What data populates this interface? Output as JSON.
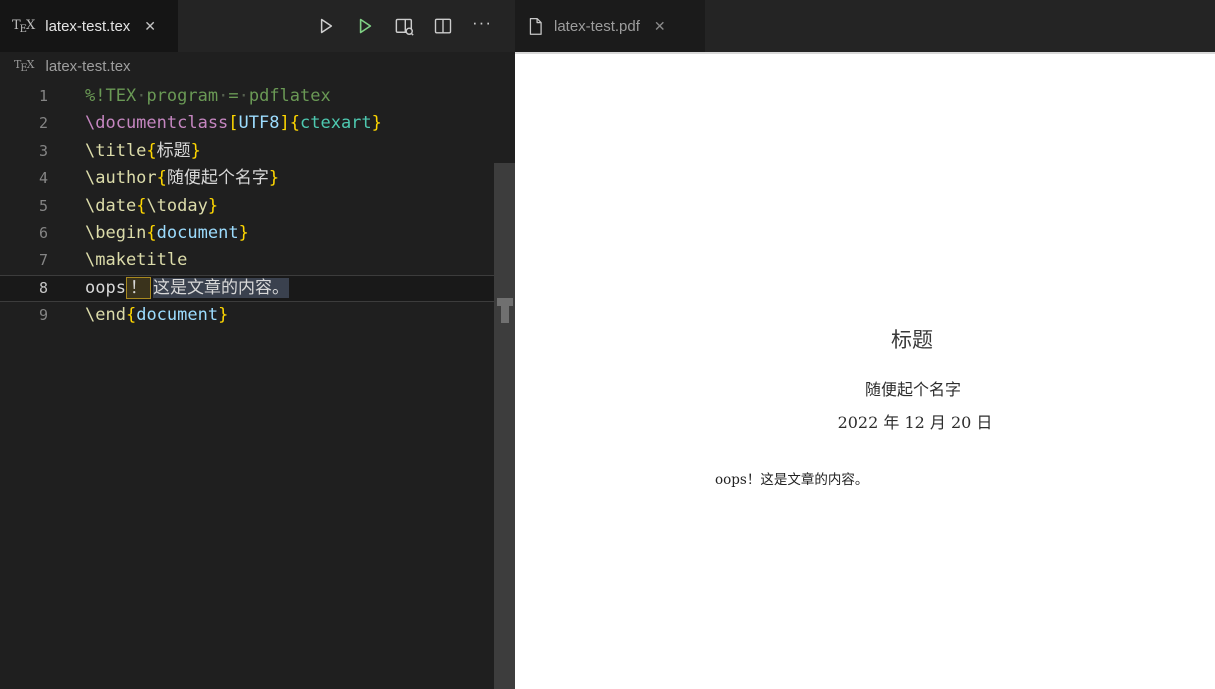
{
  "icons": {
    "close": "✕",
    "more": "···",
    "tex_t": "T",
    "tex_e": "E",
    "tex_x": "X"
  },
  "left_editor": {
    "tab": {
      "label": "latex-test.tex"
    },
    "toolbar": {
      "run": "play-outline",
      "run_green": "play-green",
      "view_pdf": "preview-with-magnifier",
      "split": "split-editor",
      "more": "more-actions"
    },
    "breadcrumb": {
      "label": "latex-test.tex"
    },
    "lines": [
      {
        "n": 1,
        "current": false,
        "spans": [
          {
            "t": "%!TEX",
            "k": "cm"
          },
          {
            "t": "·",
            "k": "ws"
          },
          {
            "t": "program",
            "k": "cm"
          },
          {
            "t": "·",
            "k": "ws"
          },
          {
            "t": "=",
            "k": "cm"
          },
          {
            "t": "·",
            "k": "ws"
          },
          {
            "t": "pdflatex",
            "k": "cm"
          }
        ]
      },
      {
        "n": 2,
        "current": false,
        "spans": [
          {
            "t": "\\documentclass",
            "k": "kw"
          },
          {
            "t": "[",
            "k": "br"
          },
          {
            "t": "UTF8",
            "k": "var"
          },
          {
            "t": "]",
            "k": "br"
          },
          {
            "t": "{",
            "k": "br"
          },
          {
            "t": "ctexart",
            "k": "cls"
          },
          {
            "t": "}",
            "k": "br"
          }
        ]
      },
      {
        "n": 3,
        "current": false,
        "spans": [
          {
            "t": "\\title",
            "k": "fn"
          },
          {
            "t": "{",
            "k": "br"
          },
          {
            "t": "标题",
            "k": "tx"
          },
          {
            "t": "}",
            "k": "br"
          }
        ]
      },
      {
        "n": 4,
        "current": false,
        "spans": [
          {
            "t": "\\author",
            "k": "fn"
          },
          {
            "t": "{",
            "k": "br"
          },
          {
            "t": "随便起个名字",
            "k": "tx"
          },
          {
            "t": "}",
            "k": "br"
          }
        ]
      },
      {
        "n": 5,
        "current": false,
        "spans": [
          {
            "t": "\\date",
            "k": "fn"
          },
          {
            "t": "{",
            "k": "br"
          },
          {
            "t": "\\today",
            "k": "fn"
          },
          {
            "t": "}",
            "k": "br"
          }
        ]
      },
      {
        "n": 6,
        "current": false,
        "spans": [
          {
            "t": "\\begin",
            "k": "fn"
          },
          {
            "t": "{",
            "k": "br"
          },
          {
            "t": "document",
            "k": "var"
          },
          {
            "t": "}",
            "k": "br"
          }
        ]
      },
      {
        "n": 7,
        "current": false,
        "spans": [
          {
            "t": "\\maketitle",
            "k": "fn"
          }
        ]
      },
      {
        "n": 8,
        "current": true,
        "spans": [
          {
            "t": "oops",
            "k": "tx"
          },
          {
            "t": "！",
            "k": "boxed"
          },
          {
            "t": "这是文章的内容。",
            "k": "sel"
          }
        ]
      },
      {
        "n": 9,
        "current": false,
        "spans": [
          {
            "t": "\\end",
            "k": "fn"
          },
          {
            "t": "{",
            "k": "br"
          },
          {
            "t": "document",
            "k": "var"
          },
          {
            "t": "}",
            "k": "br"
          }
        ]
      }
    ]
  },
  "right_editor": {
    "tab": {
      "label": "latex-test.pdf"
    },
    "pdf": {
      "title": "标题",
      "author": "随便起个名字",
      "date": "2022 年 12 月 20 日",
      "body": "oops！这是文章的内容。"
    }
  },
  "colors": {
    "comment": "#6A9955",
    "command_keyword": "#C586C0",
    "command_function": "#DCDCAA",
    "bracket": "#FFD700",
    "variable": "#9CDCFE",
    "class_name": "#4EC9B0",
    "green_run": "#7fd184",
    "unicode_box_border": "#a8891f",
    "selection_highlight": "#3a414e"
  }
}
